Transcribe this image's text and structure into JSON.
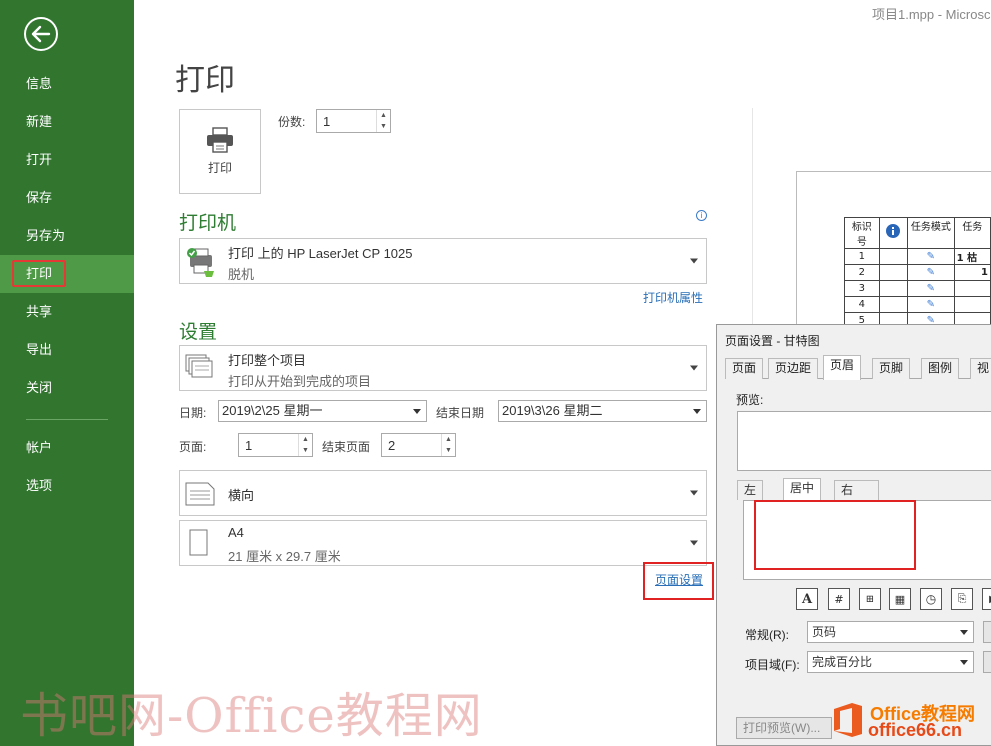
{
  "window": {
    "title": "项目1.mpp - Microsc"
  },
  "sidebar": {
    "items": [
      {
        "label": "信息"
      },
      {
        "label": "新建"
      },
      {
        "label": "打开"
      },
      {
        "label": "保存"
      },
      {
        "label": "另存为"
      },
      {
        "label": "打印",
        "active": true
      },
      {
        "label": "共享"
      },
      {
        "label": "导出"
      },
      {
        "label": "关闭"
      },
      {
        "label": "帐户"
      },
      {
        "label": "选项"
      }
    ]
  },
  "main": {
    "title": "打印",
    "print_button_label": "打印",
    "copies_label": "份数:",
    "copies_value": "1"
  },
  "printer": {
    "section_title": "打印机",
    "name": "打印 上的 HP LaserJet CP 1025",
    "status": "脱机",
    "properties_link": "打印机属性"
  },
  "settings": {
    "section_title": "设置",
    "scope_main": "打印整个项目",
    "scope_sub": "打印从开始到完成的项目",
    "date_label": "日期:",
    "date_value": "2019\\2\\25 星期一",
    "end_date_label": "结束日期",
    "end_date_value": "2019\\3\\26 星期二",
    "pages_label": "页面:",
    "pages_from": "1",
    "end_page_label": "结束页面",
    "pages_to": "2",
    "orientation": "横向",
    "paper_main": "A4",
    "paper_sub": "21 厘米 x 29.7 厘米",
    "page_setup_link": "页面设置"
  },
  "preview": {
    "headers": [
      "标识号",
      "",
      "任务模式",
      "任务"
    ],
    "rows": [
      {
        "id": "1",
        "name": "1 枯"
      },
      {
        "id": "2",
        "name": "1"
      },
      {
        "id": "3",
        "name": ""
      },
      {
        "id": "4",
        "name": ""
      },
      {
        "id": "5",
        "name": ""
      }
    ]
  },
  "dialog": {
    "title": "页面设置 - 甘特图",
    "tabs": [
      "页面",
      "页边距",
      "页眉",
      "页脚",
      "图例",
      "视"
    ],
    "active_tab": "页眉",
    "preview_label": "预览:",
    "align_tabs": [
      "左",
      "居中",
      "右"
    ],
    "general_label": "常规(R):",
    "general_value": "页码",
    "field_label": "项目域(F):",
    "field_value": "完成百分比",
    "print_preview_button": "打印预览(W)..."
  },
  "watermark": {
    "text": "书吧网-Office教程网",
    "logo_line1": "Office教程网",
    "logo_line2": "office66.cn"
  },
  "colors": {
    "sidebar": "#31752f",
    "sidebar_active": "#4f9a46",
    "accent_green": "#2e7d32",
    "link_blue": "#2a6fb7",
    "highlight_red": "#e02222"
  }
}
